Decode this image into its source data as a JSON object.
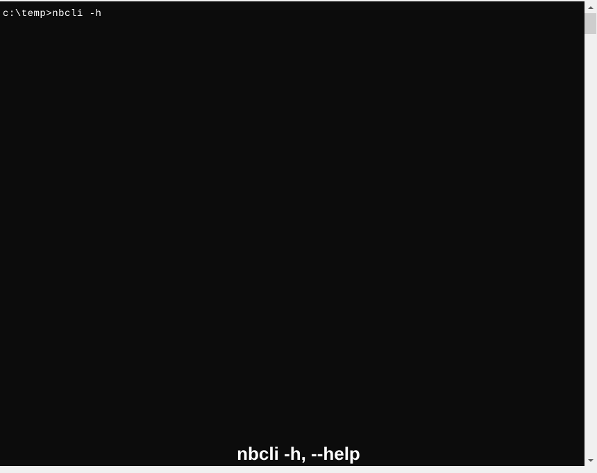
{
  "terminal": {
    "prompt": "c:\\temp>",
    "command": "nbcli -h"
  },
  "caption": "nbcli -h, --help"
}
